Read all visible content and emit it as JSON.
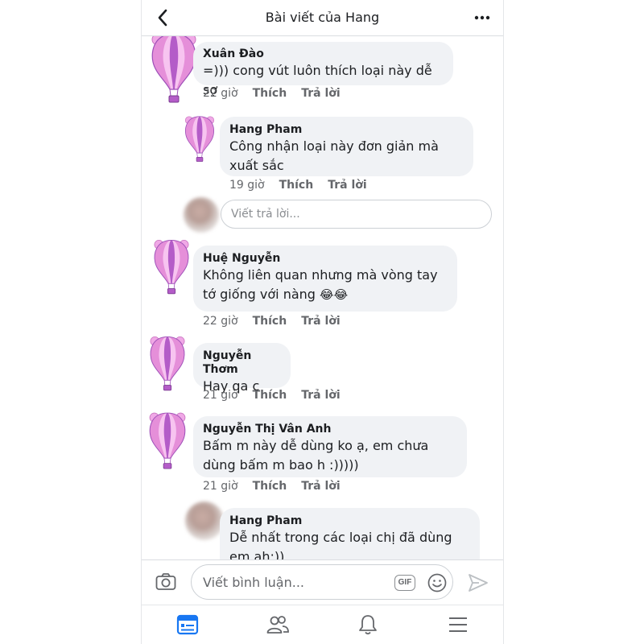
{
  "header": {
    "title": "Bài viết của Hang"
  },
  "comments": [
    {
      "author": "Xuân Đào",
      "text": "=))) cong vút luôn thích loại này dễ sợ",
      "time": "22 giờ",
      "like": "Thích",
      "reply": "Trả lời"
    },
    {
      "author": "Hang Pham",
      "text": "Công nhận loại này đơn giản mà xuất sắc",
      "time": "19 giờ",
      "like": "Thích",
      "reply": "Trả lời"
    },
    {
      "author": "Huệ Nguyễn",
      "text": "Không liên quan nhưng mà vòng tay tớ giống với nàng",
      "emoji": "😂😂",
      "time": "22 giờ",
      "like": "Thích",
      "reply": "Trả lời"
    },
    {
      "author": "Nguyễn Thơm",
      "text": "Hay qa c",
      "time": "21 giờ",
      "like": "Thích",
      "reply": "Trả lời"
    },
    {
      "author": "Nguyễn Thị Vân Anh",
      "text": "Bấm m này dễ dùng ko ạ, em chưa dùng bấm m bao h :)))))",
      "time": "21 giờ",
      "like": "Thích",
      "reply": "Trả lời"
    },
    {
      "author": "Hang Pham",
      "text": "Dễ nhất trong các loại chị đã dùng em ah:))"
    }
  ],
  "reply_input": {
    "placeholder": "Viết trả lời..."
  },
  "composer": {
    "placeholder": "Viết bình luận...",
    "gif_label": "GIF"
  },
  "icons": {
    "back": "chevron-left-icon",
    "more": "more-horizontal-icon",
    "camera": "camera-icon",
    "emoji": "smiley-icon",
    "send": "send-icon",
    "tabs": [
      "news-feed-icon",
      "friends-icon",
      "notifications-icon",
      "menu-icon"
    ]
  },
  "colors": {
    "bubble": "#f0f2f5",
    "active_tab": "#1877f2",
    "inactive_icon": "#65676b",
    "balloon_pink": "#e58fd9",
    "balloon_purple": "#9d4fb8"
  }
}
